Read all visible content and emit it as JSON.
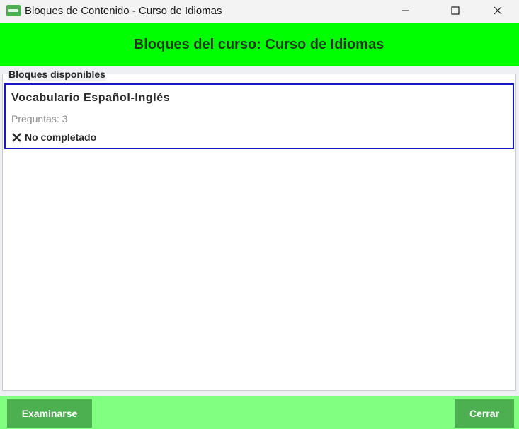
{
  "window": {
    "title": "Bloques de Contenido - Curso de Idiomas",
    "icon": "app-icon"
  },
  "header": {
    "title": "Bloques del curso: Curso de Idiomas"
  },
  "panel": {
    "legend": "Bloques disponibles",
    "blocks": [
      {
        "title": "Vocabulario Español-Inglés",
        "questions": "Preguntas: 3",
        "status": "No completado",
        "status_icon": "x-mark-icon"
      }
    ]
  },
  "footer": {
    "exam_label": "Examinarse",
    "close_label": "Cerrar"
  },
  "colors": {
    "header_bg": "#00ff00",
    "footer_bg": "#80ff80",
    "button_bg": "#4caf50",
    "card_border": "#1818c8"
  }
}
